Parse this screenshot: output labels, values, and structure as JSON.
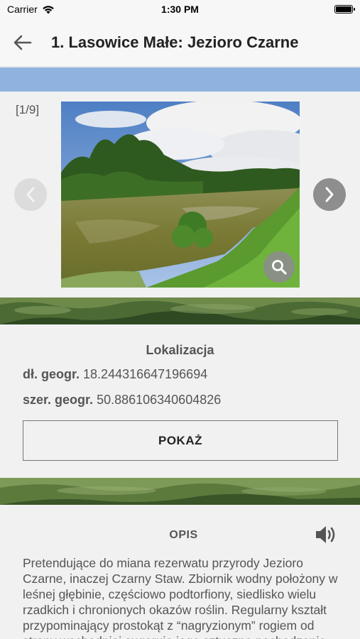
{
  "status": {
    "carrier": "Carrier",
    "time": "1:30 PM"
  },
  "nav": {
    "title": "1. Lasowice Małe: Jezioro Czarne"
  },
  "gallery": {
    "counter": "[1/9]"
  },
  "location": {
    "title": "Lokalizacja",
    "lon_label": "dł. geogr.",
    "lon_value": "18.244316647196694",
    "lat_label": "szer. geogr.",
    "lat_value": "50.886106340604826",
    "show_button": "POKAŻ"
  },
  "description": {
    "title": "OPIS",
    "text": "Pretendujące do miana rezerwatu przyrody Jezioro Czarne, inaczej Czarny Staw. Zbiornik wodny położony w leśnej głębinie, częściowo podtorfiony, siedlisko wielu rzadkich i chronionych okazów roślin. Regularny kształt przypominający prostokąt z “nagryzionym” rogiem od strony wschodniej sugeruje jego sztuczne pochodzenie."
  },
  "icons": {
    "back": "arrow-left-icon",
    "prev": "chevron-left-icon",
    "next": "chevron-right-icon",
    "zoom": "magnifier-icon",
    "speaker": "speaker-icon",
    "wifi": "wifi-icon",
    "battery": "battery-icon"
  },
  "colors": {
    "header_strip": "#8fb3de",
    "background": "#f1f1f1",
    "nav_background": "#f7f7f7"
  }
}
